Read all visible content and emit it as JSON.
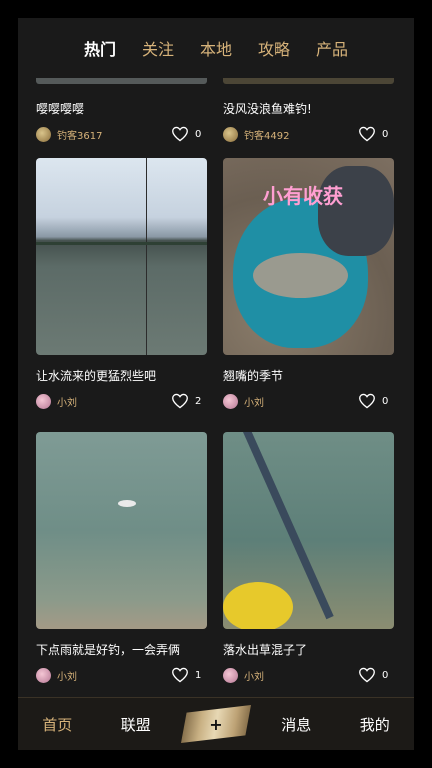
{
  "tabs": [
    "热门",
    "关注",
    "本地",
    "攻略",
    "产品"
  ],
  "top_cards": [
    {
      "title": "嘤嘤嘤嘤",
      "author": "钓客3617",
      "likes": "0"
    },
    {
      "title": "没风没浪鱼难钓!",
      "author": "钓客4492",
      "likes": "0"
    }
  ],
  "cards": [
    {
      "title": "让水流来的更猛烈些吧",
      "author": "小刘",
      "likes": "2"
    },
    {
      "title": "翘嘴的季节",
      "author": "小刘",
      "likes": "0",
      "image_text": "小有收获"
    },
    {
      "title": "下点雨就是好钓，一会弄俩",
      "author": "小刘",
      "likes": "1"
    },
    {
      "title": "落水出草混子了",
      "author": "小刘",
      "likes": "0"
    }
  ],
  "nav": {
    "home": "首页",
    "league": "联盟",
    "plus": "+",
    "messages": "消息",
    "me": "我的"
  },
  "colors": {
    "accent": "#d7b37a",
    "background": "#1a1a1a"
  },
  "icons": [
    "heart-icon",
    "avatar"
  ]
}
